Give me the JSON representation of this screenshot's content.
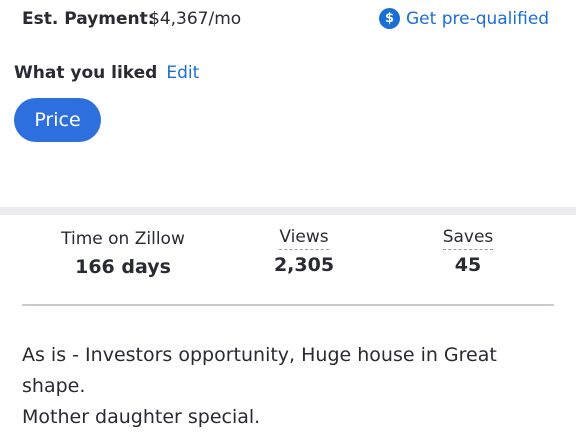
{
  "payment": {
    "label": "Est. Payment:",
    "value": "$4,367/mo",
    "prequal_icon": "dollar-circle-icon",
    "prequal_label": "Get pre-qualified"
  },
  "liked": {
    "label": "What you liked",
    "edit_label": "Edit",
    "chips": [
      "Price"
    ]
  },
  "stats": {
    "time_on_zillow": {
      "label": "Time on Zillow",
      "value": "166 days"
    },
    "views": {
      "label": "Views",
      "value": "2,305"
    },
    "saves": {
      "label": "Saves",
      "value": "45"
    }
  },
  "description": {
    "line1": "As is - Investors opportunity, Huge house in Great shape.",
    "line2": "Mother daughter special."
  },
  "colors": {
    "accent": "#1a6fd4",
    "chip": "#2e6fe0",
    "text": "#2a2a33",
    "band": "#ececee"
  }
}
